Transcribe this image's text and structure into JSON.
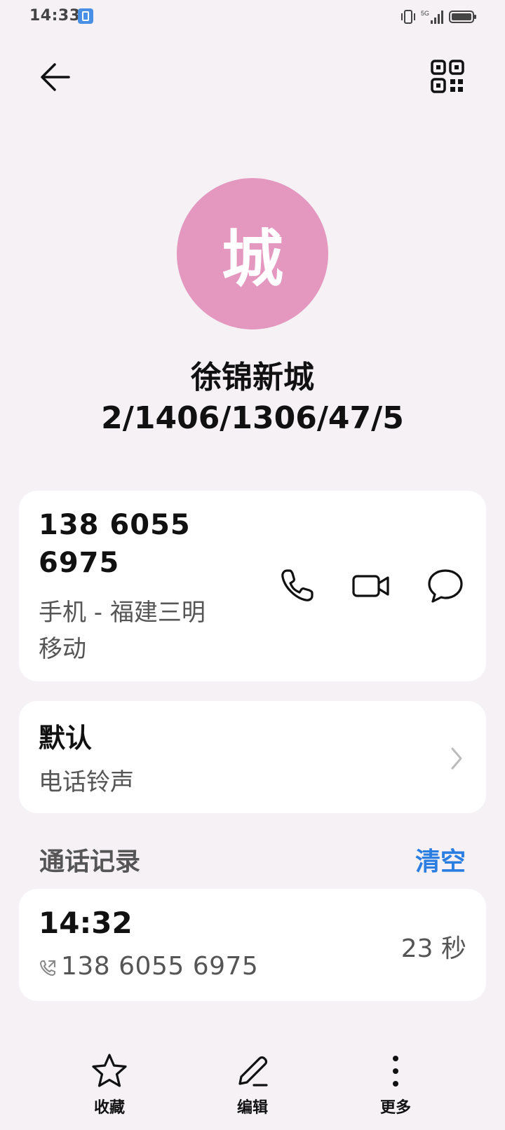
{
  "status_bar": {
    "time": "14:33",
    "network": "5G",
    "icons": [
      "contacts-app-icon",
      "vibrate-icon",
      "signal-icon",
      "battery-icon"
    ]
  },
  "top_bar": {
    "back_icon": "arrow-left-icon",
    "qr_icon": "qr-code-icon"
  },
  "contact": {
    "avatar_letter": "城",
    "avatar_color": "#e598bf",
    "name_line1": "徐锦新城",
    "name_line2": "2/1406/1306/47/5"
  },
  "phone_card": {
    "number_line1": "138 6055",
    "number_line2": "6975",
    "type_line1": "手机 - 福建三明",
    "type_line2": "移动",
    "actions": [
      "phone-icon",
      "video-call-icon",
      "message-icon"
    ]
  },
  "ringtone_card": {
    "title": "默认",
    "subtitle": "电话铃声"
  },
  "call_log": {
    "section_title": "通话记录",
    "clear_label": "清空",
    "clear_color": "#2a7de1",
    "entries": [
      {
        "time": "14:32",
        "number": "138 6055 6975",
        "duration": "23 秒"
      }
    ]
  },
  "bottom_bar": {
    "items": [
      {
        "label": "收藏",
        "icon": "star-icon"
      },
      {
        "label": "编辑",
        "icon": "edit-icon"
      },
      {
        "label": "更多",
        "icon": "more-vertical-icon"
      }
    ]
  }
}
